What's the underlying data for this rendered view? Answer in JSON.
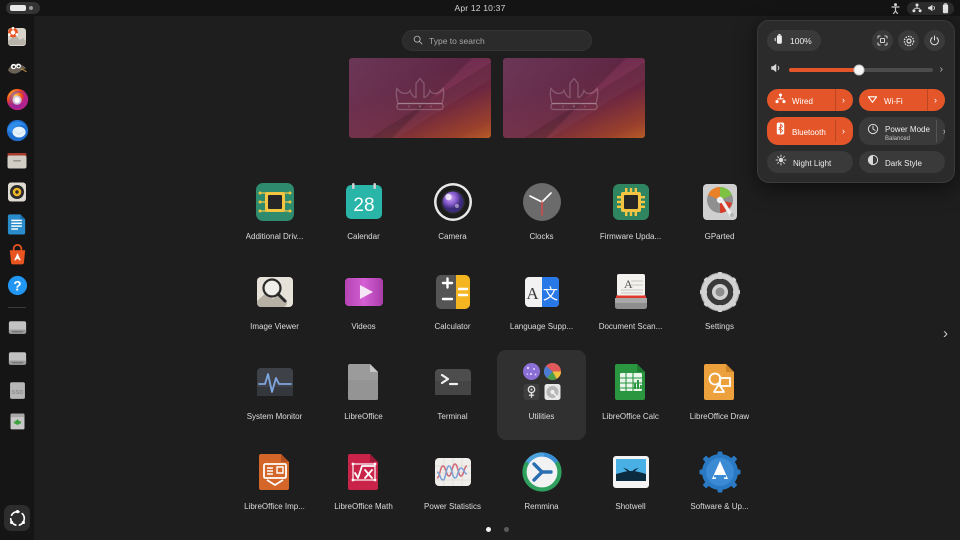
{
  "topbar": {
    "clock": "Apr 12  10:37",
    "left_indicator": "window-list-pill",
    "icons": [
      "accessibility-icon",
      "network-wired-icon",
      "volume-icon",
      "battery-icon"
    ]
  },
  "dock": {
    "items": [
      {
        "name": "dock-item-nautilus",
        "label": "Files"
      },
      {
        "name": "dock-item-gimp",
        "label": "GIMP"
      },
      {
        "name": "dock-item-firefox",
        "label": "Firefox"
      },
      {
        "name": "dock-item-thunderbird",
        "label": "Thunderbird"
      },
      {
        "name": "dock-item-file-manager",
        "label": "File Manager"
      },
      {
        "name": "dock-item-rhythmbox",
        "label": "Rhythmbox"
      },
      {
        "name": "dock-item-libreoffice-writer",
        "label": "LibreOffice Writer"
      },
      {
        "name": "dock-item-ubuntu-software",
        "label": "Ubuntu Software"
      },
      {
        "name": "dock-item-help",
        "label": "Help"
      },
      {
        "name": "dock-item-drive-1",
        "label": "Disk"
      },
      {
        "name": "dock-item-drive-2",
        "label": "Disk"
      },
      {
        "name": "dock-item-ssd",
        "label": "SSD"
      },
      {
        "name": "dock-item-trash",
        "label": "Trash"
      }
    ],
    "show_apps_label": "Show Applications"
  },
  "search": {
    "placeholder": "Type to search",
    "value": ""
  },
  "workspaces": {
    "count": 2,
    "items": [
      {
        "name": "workspace-thumbnail-1"
      },
      {
        "name": "workspace-thumbnail-2"
      }
    ]
  },
  "grid": {
    "page_next_glyph": "›",
    "apps": [
      {
        "id": "additional-drivers",
        "label": "Additional Driv...",
        "icon": "chip-board-icon"
      },
      {
        "id": "calendar",
        "label": "Calendar",
        "icon": "calendar-icon",
        "badge": "28"
      },
      {
        "id": "camera",
        "label": "Camera",
        "icon": "camera-icon"
      },
      {
        "id": "clocks",
        "label": "Clocks",
        "icon": "clock-icon"
      },
      {
        "id": "firmware-updater",
        "label": "Firmware Upda...",
        "icon": "chip-board-icon"
      },
      {
        "id": "gparted",
        "label": "GParted",
        "icon": "disk-partition-icon"
      },
      {
        "id": "image-viewer",
        "label": "Image Viewer",
        "icon": "magnifier-photo-icon"
      },
      {
        "id": "videos",
        "label": "Videos",
        "icon": "play-icon"
      },
      {
        "id": "calculator",
        "label": "Calculator",
        "icon": "calculator-icon"
      },
      {
        "id": "language-support",
        "label": "Language Supp...",
        "icon": "translate-icon"
      },
      {
        "id": "document-scanner",
        "label": "Document Scan...",
        "icon": "scanner-icon"
      },
      {
        "id": "settings",
        "label": "Settings",
        "icon": "gear-icon"
      },
      {
        "id": "system-monitor",
        "label": "System Monitor",
        "icon": "waveform-icon"
      },
      {
        "id": "libreoffice",
        "label": "LibreOffice",
        "icon": "libreoffice-icon"
      },
      {
        "id": "terminal",
        "label": "Terminal",
        "icon": "terminal-icon"
      },
      {
        "id": "utilities",
        "label": "Utilities",
        "icon": "folder-utilities-icon",
        "folder": true
      },
      {
        "id": "libreoffice-calc",
        "label": "LibreOffice Calc",
        "icon": "libreoffice-calc-icon"
      },
      {
        "id": "libreoffice-draw",
        "label": "LibreOffice Draw",
        "icon": "libreoffice-draw-icon"
      },
      {
        "id": "libreoffice-impress",
        "label": "LibreOffice Imp...",
        "icon": "libreoffice-impress-icon"
      },
      {
        "id": "libreoffice-math",
        "label": "LibreOffice Math",
        "icon": "libreoffice-math-icon"
      },
      {
        "id": "power-statistics",
        "label": "Power Statistics",
        "icon": "power-graph-icon"
      },
      {
        "id": "remmina",
        "label": "Remmina",
        "icon": "remmina-icon"
      },
      {
        "id": "shotwell",
        "label": "Shotwell",
        "icon": "shotwell-icon"
      },
      {
        "id": "software-updater",
        "label": "Software & Up...",
        "icon": "software-updater-icon"
      }
    ],
    "pages": [
      {
        "active": true
      },
      {
        "active": false
      }
    ]
  },
  "quick_settings": {
    "battery_percent": "100%",
    "buttons": {
      "screenshot": "screenshot-icon",
      "settings": "gear-icon",
      "power": "power-icon"
    },
    "volume": {
      "value": 49,
      "expand_glyph": "›"
    },
    "tiles": [
      {
        "id": "wired",
        "label": "Wired",
        "sub": "",
        "on": true,
        "arrow": "›",
        "icon": "network-wired-icon"
      },
      {
        "id": "wifi",
        "label": "Wi-Fi",
        "sub": "",
        "on": true,
        "arrow": "›",
        "icon": "wifi-icon"
      },
      {
        "id": "bluetooth",
        "label": "Bluetooth",
        "sub": "",
        "on": true,
        "arrow": "›",
        "icon": "bluetooth-icon"
      },
      {
        "id": "power-mode",
        "label": "Power Mode",
        "sub": "Balanced",
        "on": false,
        "arrow": "›",
        "icon": "power-mode-icon"
      },
      {
        "id": "night-light",
        "label": "Night Light",
        "sub": "",
        "on": false,
        "arrow": "",
        "icon": "night-light-icon"
      },
      {
        "id": "dark-style",
        "label": "Dark Style",
        "sub": "",
        "on": false,
        "arrow": "",
        "icon": "dark-style-icon"
      }
    ]
  },
  "colors": {
    "accent": "#e4562a",
    "panel": "#2b2b2b",
    "desktop": "#1e1e1e",
    "topbar": "#141414"
  }
}
